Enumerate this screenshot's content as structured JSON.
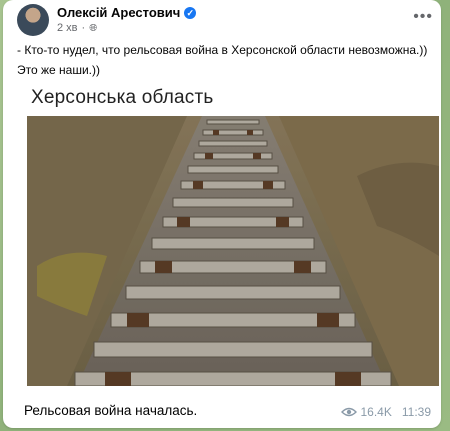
{
  "post": {
    "author": "Олексій Арестович",
    "time_ago": "2 хв",
    "line1": "- Кто-то нудел, что рельсовая война в Херсонской области невозможна.))",
    "line2": "Это же наши.))",
    "image_caption": "Херсонська область"
  },
  "message": {
    "caption": "Рельсовая война началась.",
    "views": "16.4K",
    "time": "11:39"
  },
  "icons": {
    "verified": "verified-badge-icon",
    "globe": "globe-icon",
    "more": "more-options-icon",
    "views": "eye-icon"
  },
  "colors": {
    "verified": "#1877f2",
    "meta": "#65676b",
    "stats": "#8a9aa8"
  }
}
